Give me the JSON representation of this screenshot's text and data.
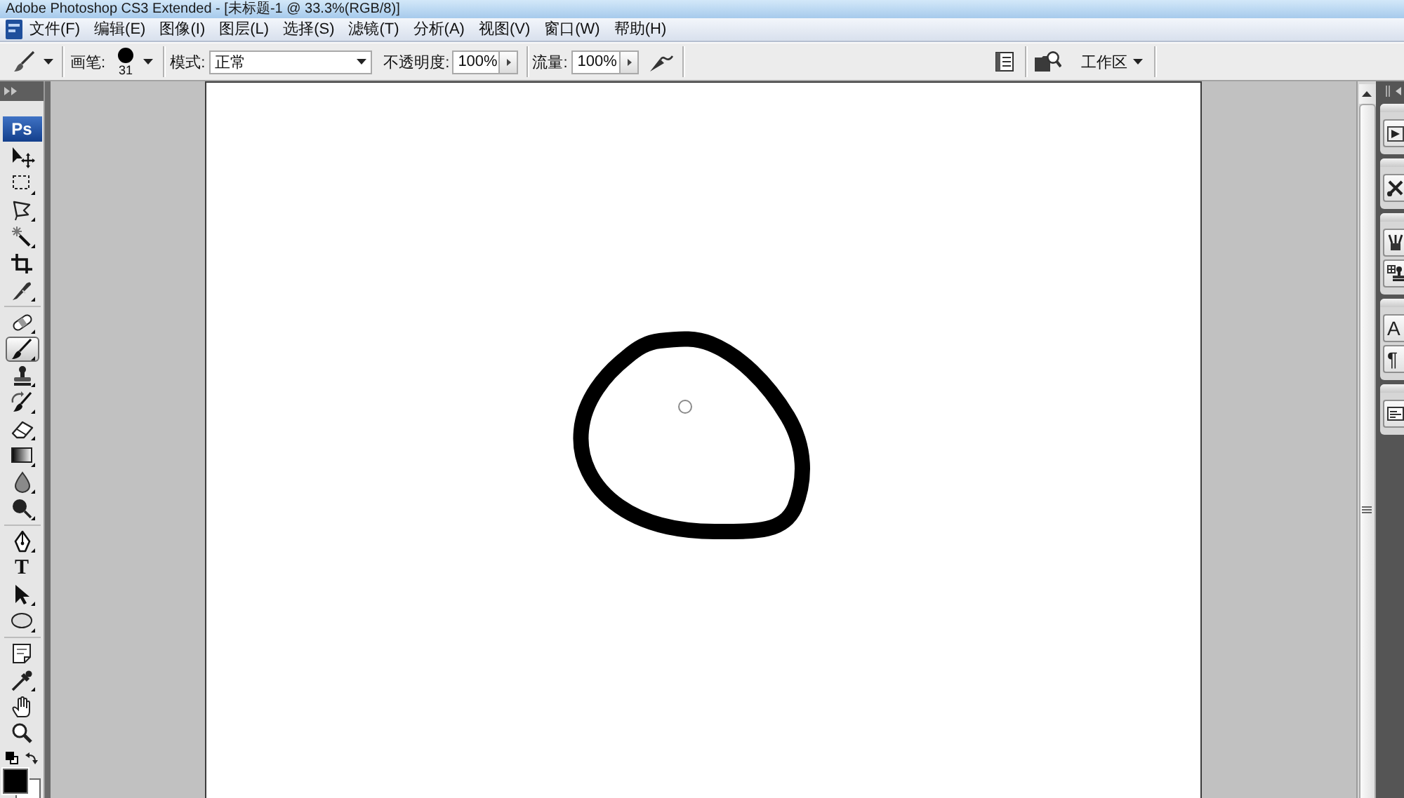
{
  "window": {
    "title": "Adobe Photoshop CS3 Extended - [未标题-1 @ 33.3%(RGB/8)]"
  },
  "menu_bar": {
    "items": [
      "文件(F)",
      "编辑(E)",
      "图像(I)",
      "图层(L)",
      "选择(S)",
      "滤镜(T)",
      "分析(A)",
      "视图(V)",
      "窗口(W)",
      "帮助(H)"
    ]
  },
  "options_bar": {
    "brush_label": "画笔:",
    "brush_size": "31",
    "mode_label": "模式:",
    "mode": "正常",
    "opacity_label": "不透明度:",
    "opacity": "100%",
    "flow_label": "流量:",
    "flow": "100%",
    "workspace_button": "工作区"
  },
  "toolbox": {
    "logo": "Ps",
    "groups": [
      {
        "tools": [
          {
            "kind": "move",
            "selected": false
          },
          {
            "kind": "marquee",
            "selected": false
          },
          {
            "kind": "lasso",
            "selected": false
          },
          {
            "kind": "wand",
            "selected": false
          },
          {
            "kind": "crop",
            "selected": false
          },
          {
            "kind": "slice",
            "selected": false
          }
        ]
      },
      {
        "tools": [
          {
            "kind": "heal",
            "selected": false
          },
          {
            "kind": "brush",
            "selected": true
          },
          {
            "kind": "stamp",
            "selected": false
          },
          {
            "kind": "history_brush",
            "selected": false
          },
          {
            "kind": "eraser",
            "selected": false
          },
          {
            "kind": "gradient",
            "selected": false
          },
          {
            "kind": "blur",
            "selected": false
          },
          {
            "kind": "dodge",
            "selected": false
          }
        ]
      },
      {
        "tools": [
          {
            "kind": "pen",
            "selected": false
          },
          {
            "kind": "type",
            "glyph": "T",
            "selected": false
          },
          {
            "kind": "path_select",
            "selected": false
          },
          {
            "kind": "ellipse",
            "selected": false
          }
        ]
      },
      {
        "tools": [
          {
            "kind": "note",
            "selected": false
          },
          {
            "kind": "eyedropper",
            "selected": false
          },
          {
            "kind": "hand",
            "selected": false
          },
          {
            "kind": "zoom",
            "selected": false
          }
        ]
      }
    ],
    "colors": [
      {
        "kind": "foreground",
        "color": "#000000"
      },
      {
        "kind": "background",
        "color": "#ffffff"
      }
    ]
  },
  "dock": {
    "groups": [
      {
        "buttons": [
          {
            "kind": "play"
          }
        ]
      },
      {
        "buttons": [
          {
            "kind": "crossed_tools"
          }
        ]
      },
      {
        "buttons": [
          {
            "kind": "brush_pot"
          },
          {
            "kind": "stamp_grid"
          }
        ]
      },
      {
        "buttons": [
          {
            "kind": "letter",
            "glyph": "A"
          },
          {
            "kind": "pilcrow",
            "glyph": "¶"
          }
        ]
      },
      {
        "buttons": [
          {
            "kind": "card"
          }
        ]
      }
    ]
  }
}
